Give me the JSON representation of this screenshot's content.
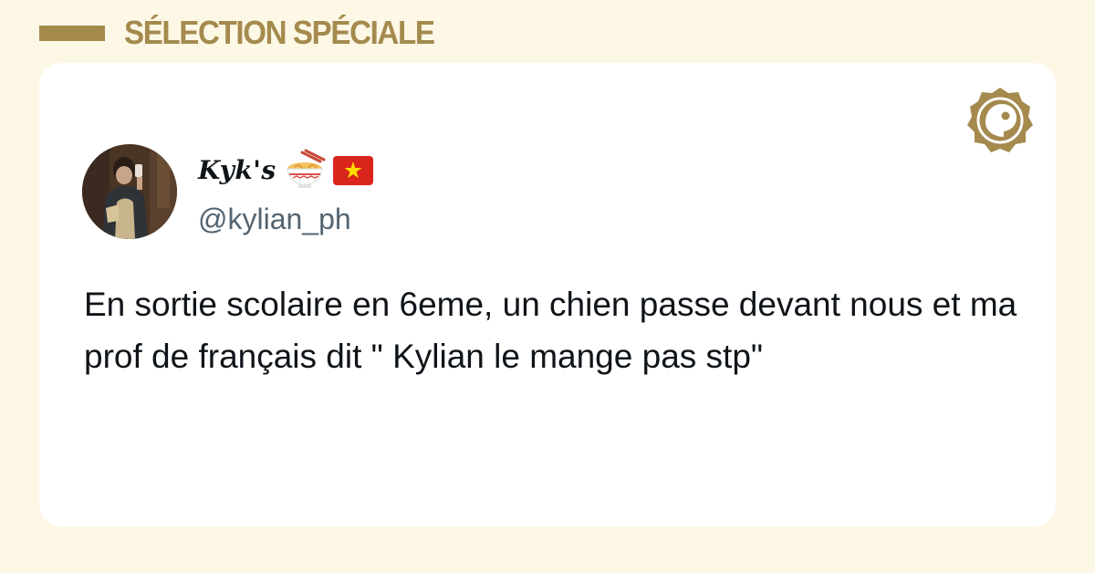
{
  "header": {
    "section_label": "SÉLECTION SPÉCIALE"
  },
  "colors": {
    "background": "#fdf7e5",
    "accent": "#a58a4e",
    "card": "#ffffff",
    "text": "#0f1419",
    "handle": "#536471"
  },
  "brand": {
    "icon": "brand-badge-icon"
  },
  "tweet": {
    "author": {
      "display_name": "Kyk's",
      "emojis": [
        "ramen-bowl-icon",
        "vietnam-flag-icon"
      ],
      "handle": "@kylian_ph",
      "avatar": "avatar"
    },
    "text": "En sortie scolaire en 6eme, un chien passe devant nous et ma prof de français dit \" Kylian le mange pas stp\""
  }
}
